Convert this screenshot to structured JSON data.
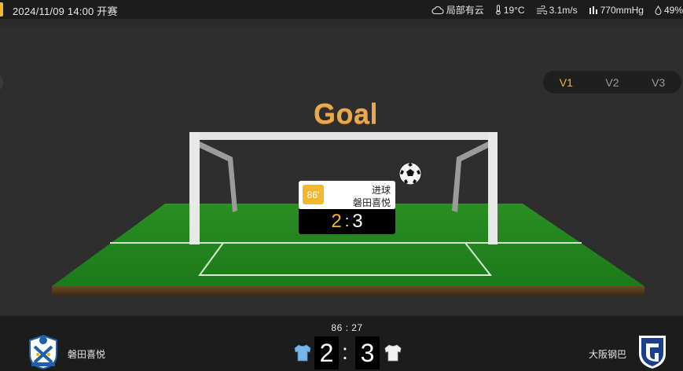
{
  "topbar": {
    "datetime": "2024/11/09 14:00 开赛",
    "weather": {
      "condition": "局部有云",
      "temperature": "19°C",
      "wind": "3.1m/s",
      "pressure": "770mmHg",
      "humidity": "49%"
    }
  },
  "view_tabs": [
    "V1",
    "V2",
    "V3"
  ],
  "active_tab": "V1",
  "event": {
    "title": "Goal",
    "minute": "86'",
    "type": "进球",
    "team": "磐田喜悦",
    "score_home": "2",
    "score_away": "3",
    "score_sep": ":"
  },
  "match": {
    "clock": "86 : 27",
    "home_team": "磐田喜悦",
    "away_team": "大阪钢巴",
    "home_score": "2",
    "away_score": "3",
    "score_sep": ":"
  },
  "colors": {
    "accent": "#f1b82d",
    "title": "#e9a94c",
    "grass": "#2f9a2a",
    "background": "#2e2e2e",
    "bar": "#1c1c1c"
  },
  "icons": [
    "cloud-icon",
    "thermometer-icon",
    "wind-icon",
    "pressure-icon",
    "humidity-icon",
    "soccer-ball-icon",
    "home-jersey-icon",
    "away-jersey-icon"
  ]
}
